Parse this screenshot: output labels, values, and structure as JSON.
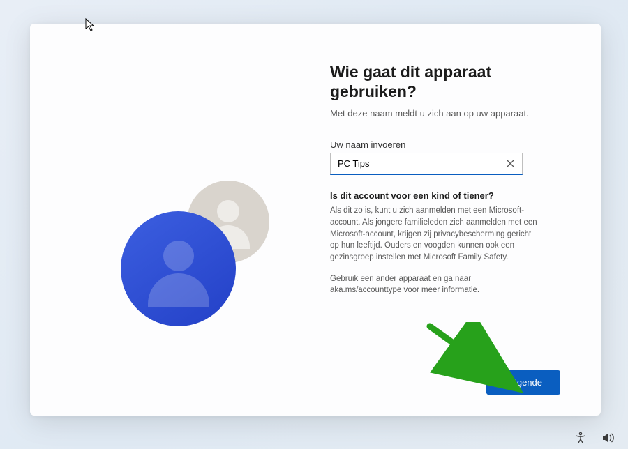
{
  "heading": "Wie gaat dit apparaat gebruiken?",
  "subheading": "Met deze naam meldt u zich aan op uw apparaat.",
  "name_field": {
    "label": "Uw naam invoeren",
    "value": "PC Tips"
  },
  "child_section": {
    "title": "Is dit account voor een kind of tiener?",
    "body": "Als dit zo is, kunt u zich aanmelden met een Microsoft-account. Als jongere familieleden zich aanmelden met een Microsoft-account, krijgen zij privacybescherming gericht op hun leeftijd. Ouders en voogden kunnen ook een gezinsgroep instellen met Microsoft Family Safety.",
    "more": "Gebruik een ander apparaat en ga naar aka.ms/accounttype voor meer informatie."
  },
  "next_button": "Volgende",
  "colors": {
    "accent": "#0a5ec0"
  },
  "annotation_arrow": {
    "color": "#27a11b"
  }
}
